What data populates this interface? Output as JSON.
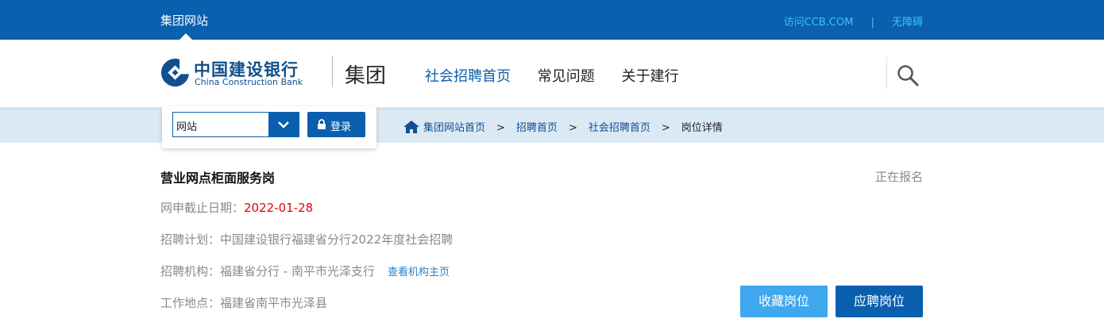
{
  "topbar": {
    "site_label": "集团网站",
    "visit_link": "访问CCB.COM",
    "separator": "|",
    "accessibility_link": "无障碍"
  },
  "header": {
    "logo_cn": "中国建设银行",
    "logo_en": "China Construction Bank",
    "group_label": "集团",
    "nav": [
      "社会招聘首页",
      "常见问题",
      "关于建行"
    ],
    "active_nav": "社会招聘首页"
  },
  "panel": {
    "select_value": "网站",
    "login_label": "登录"
  },
  "breadcrumb": {
    "items": [
      "集团网站首页",
      "招聘首页",
      "社会招聘首页"
    ],
    "separator": ">",
    "current": "岗位详情"
  },
  "job": {
    "title": "营业网点柜面服务岗",
    "status": "正在报名",
    "deadline_label": "网申截止日期：",
    "deadline_value": "2022-01-28",
    "plan_label": "招聘计划：",
    "plan_value": "中国建设银行福建省分行2022年度社会招聘",
    "org_label": "招聘机构：",
    "org_value": "福建省分行 - 南平市光泽支行",
    "org_link": "查看机构主页",
    "location_label": "工作地点：",
    "location_value": "福建省南平市光泽县"
  },
  "actions": {
    "favorite_label": "收藏岗位",
    "apply_label": "应聘岗位"
  },
  "colors": {
    "brand_blue": "#0a5fae",
    "light_blue": "#3ea7ee",
    "deadline_red": "#e60012",
    "crumb_bg": "#dbe9f5"
  }
}
